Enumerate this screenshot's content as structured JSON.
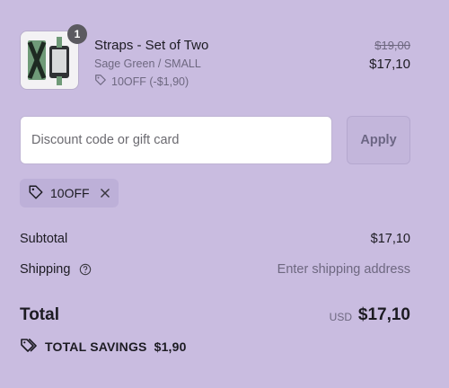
{
  "line_item": {
    "quantity": "1",
    "title": "Straps - Set of Two",
    "variant": "Sage Green / SMALL",
    "discount": "10OFF (-$1,90)",
    "original_price": "$19,00",
    "price": "$17,10",
    "image_icon": "product-thumbnail",
    "image_colors": [
      "#1e2a22",
      "#6f9a78",
      "#4c4e52"
    ]
  },
  "discount_form": {
    "placeholder": "Discount code or gift card",
    "apply_label": "Apply"
  },
  "applied_code": {
    "code": "10OFF",
    "icon": "tag-icon",
    "remove_icon": "close-icon"
  },
  "summary": {
    "subtotal_label": "Subtotal",
    "subtotal_value": "$17,10",
    "shipping_label": "Shipping",
    "shipping_value": "Enter shipping address",
    "shipping_help_icon": "help-circle-icon",
    "total_label": "Total",
    "currency": "USD",
    "total_value": "$17,10",
    "savings_label": "TOTAL SAVINGS",
    "savings_value": "$1,90"
  },
  "colors": {
    "background": "#c9bce0",
    "text": "#1c1b22",
    "muted": "#6e6880"
  }
}
